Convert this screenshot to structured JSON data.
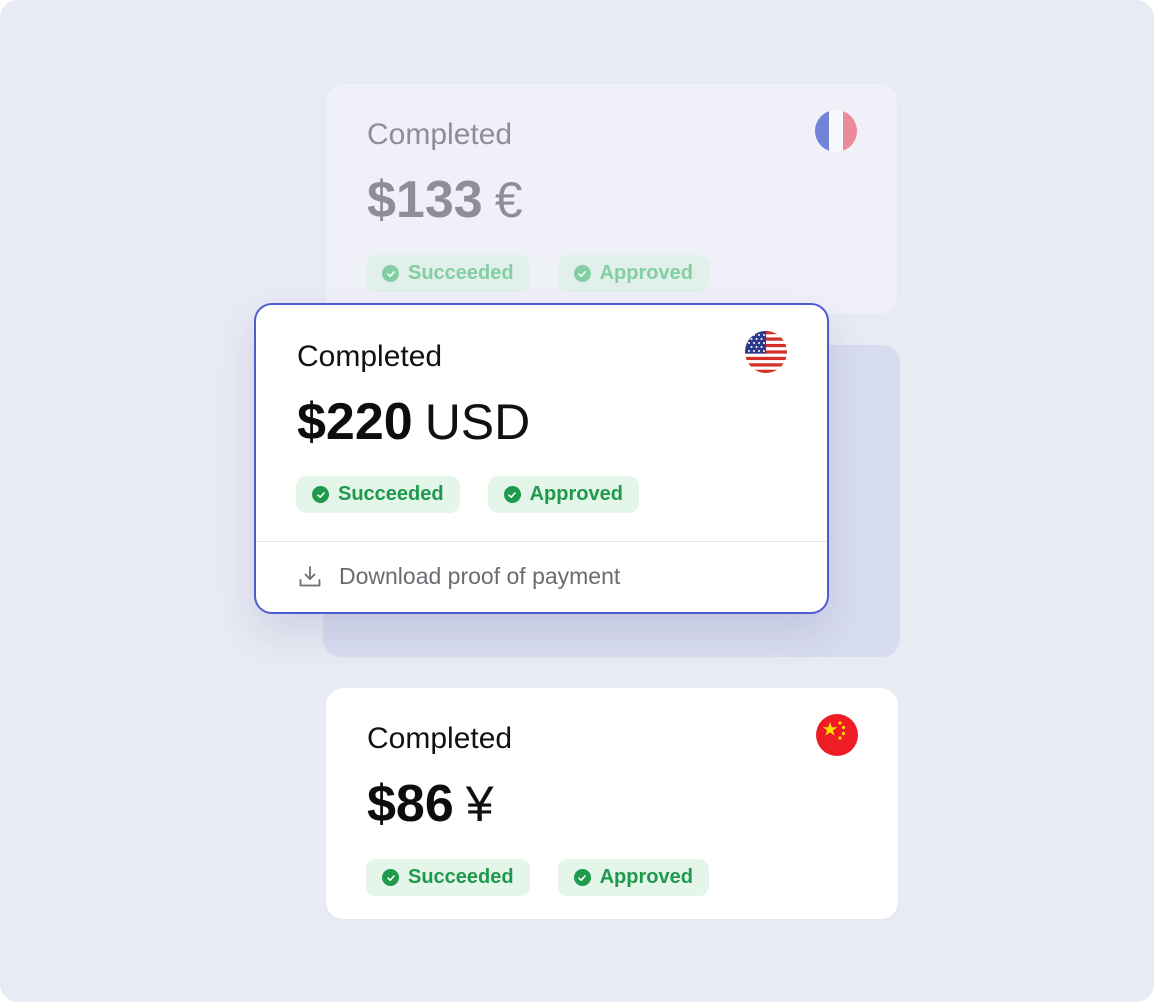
{
  "cards": [
    {
      "status": "Completed",
      "amount": "$133",
      "currency": "€",
      "flag": "france-flag-icon",
      "badges": [
        "Succeeded",
        "Approved"
      ]
    },
    {
      "status": "Completed",
      "amount": "$220",
      "currency": "USD",
      "flag": "usa-flag-icon",
      "badges": [
        "Succeeded",
        "Approved"
      ],
      "download_label": "Download proof of payment"
    },
    {
      "status": "Completed",
      "amount": "$86",
      "currency": "¥",
      "flag": "china-flag-icon",
      "badges": [
        "Succeeded",
        "Approved"
      ]
    }
  ],
  "colors": {
    "background": "#e8eaf4",
    "accent_border": "#4f5bd5",
    "success_text": "#1f9a4c",
    "success_bg": "#e4f5ea"
  }
}
